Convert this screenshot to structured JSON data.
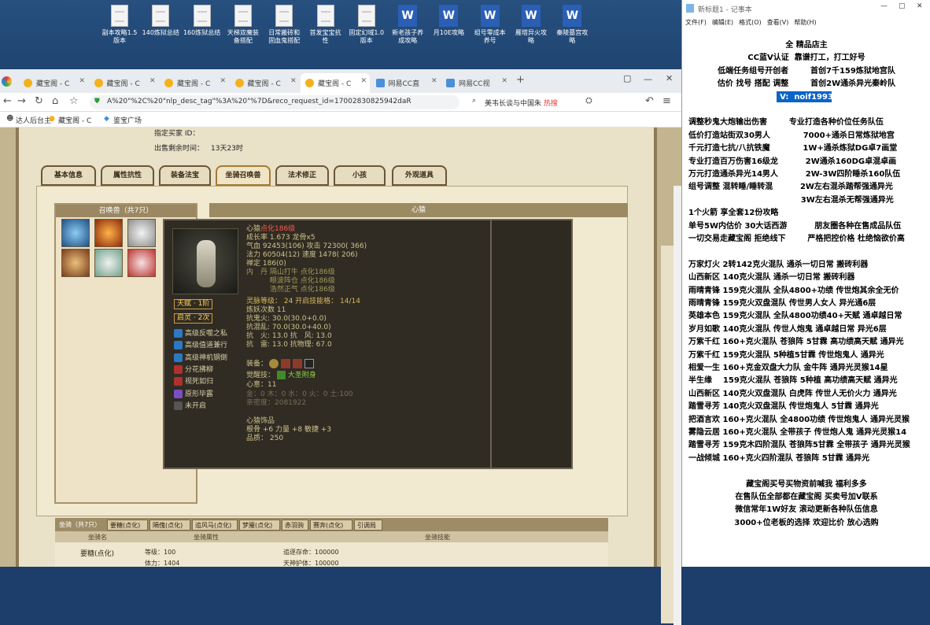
{
  "desktop_icons": [
    {
      "label": "副本攻略1.5\n版本",
      "type": "doc"
    },
    {
      "label": "140炼狱总结",
      "type": "doc"
    },
    {
      "label": "160炼狱总结",
      "type": "doc"
    },
    {
      "label": "天梯双魔装\n备搭配",
      "type": "doc"
    },
    {
      "label": "日常搬砖和\n固血鬼搭配",
      "type": "doc"
    },
    {
      "label": "首发宝宝抗\n性",
      "type": "doc"
    },
    {
      "label": "固定幻域1.0\n版本",
      "type": "doc"
    },
    {
      "label": "新老孩子养\n成攻略",
      "type": "word"
    },
    {
      "label": "月10E攻略",
      "type": "word"
    },
    {
      "label": "组号零成本\n养号",
      "type": "word"
    },
    {
      "label": "雁塔异火攻\n略",
      "type": "word"
    },
    {
      "label": "秦陵墓宫攻\n略",
      "type": "word"
    }
  ],
  "browser": {
    "tabs": [
      {
        "label": "藏宝阁 - C"
      },
      {
        "label": "藏宝阁 - C"
      },
      {
        "label": "藏宝阁 - C"
      },
      {
        "label": "藏宝阁 - C"
      },
      {
        "label": "藏宝阁 - C"
      },
      {
        "label": "网易CC直"
      },
      {
        "label": "网易CC视"
      }
    ],
    "url": "A%20\"%2C%20\"nlp_desc_tag\"%3A%20\"%7D&reco_request_id=17002830825942daR",
    "search": "美韦长谈与中国朱",
    "hot_label": "热搜",
    "bookmarks": [
      "达人后台主",
      "藏宝阁 - C",
      "鉴宝广场"
    ]
  },
  "page": {
    "seller_line": "指定买家 ID：",
    "remaining_label": "出售剩余时间：",
    "remaining_value": "13天23时",
    "tabs": [
      "基本信息",
      "属性抗性",
      "装备法宝",
      "坐骑召唤兽",
      "法术修正",
      "小孩",
      "外观道具"
    ],
    "summon_title": "召唤兽（共7只）",
    "xinhou_title": "心猿",
    "tooltip": {
      "name": "心猿",
      "name_tag": "点化186级",
      "lines": [
        "成长率 1.673  龙骨x5",
        "气血 92453(106) 攻击 72300( 366)",
        "法力 60504(12) 速度 1478( 206)",
        "禅定 186(0)",
        "内　丹 隔山打牛 点化186级",
        "　　　 眼波阵仓 点化186级",
        "　　　 浩然正气 点化186级",
        "灵脉等级：  24 开启技能格： 14/14",
        "炼妖次数 11",
        "抗鬼火: 30.0(30.0+0.0)",
        "抗混乱: 70.0(30.0+40.0)",
        "抗　火: 13.0 抗　风: 13.0",
        "抗　雷: 13.0 抗物理: 67.0"
      ],
      "equip_label": "装备：",
      "awaken_label": "觉醒技：",
      "awaken_value": "大圣附身",
      "heart_label": "心意：",
      "heart_value": "11",
      "elements": "金：0 木：0 水：0 火：0 土:100",
      "intimacy": "亲密度：2081922",
      "ornament_title": "心猿饰品",
      "ornament_stats": "根骨 +6 力量 +8 敏捷 +3",
      "ornament_quality": "品质：  250",
      "badges": [
        "天赋 · 1阶",
        "启灵 · 2次"
      ],
      "skills": [
        "高级反噬之私",
        "高级值道兼行",
        "高级神机钢倒",
        "分花拂柳",
        "视死如归",
        "原形毕露",
        "未开启"
      ]
    },
    "bottom_tabs": [
      "坐骑（共7只）",
      "要糖(点化)",
      "隔傀(点化)",
      "追风马(点化)",
      "梦魇(点化)",
      "赤羽驹",
      "赛奔(点化)",
      "引调局"
    ],
    "bottom_headers": [
      "坐骑名",
      "坐骑属性",
      "坐骑技能"
    ],
    "mount_name": "要糖(点化)",
    "mount_level": "等级：100",
    "mount_stamina": "体力：1404",
    "mount_stat1": "追逐存命：100000",
    "mount_stat2": "天神护体：100000"
  },
  "notepad": {
    "title": "新标题1 - 记事本",
    "menu": [
      "文件(F)",
      "编辑(E)",
      "格式(O)",
      "查看(V)",
      "帮助(H)"
    ],
    "lines": [
      "全 精品店主",
      "CC蓝V认证  靠谱打工，打工好号",
      "低端任务组号开创者        首创7千159炼狱地宫队",
      "估价 找号 搭配 调整        首创2W通杀异光秦岭队",
      "V:  noif1993",
      "",
      "调整秒鬼大炮输出伤害        专业打造各种价位任务队伍",
      "低价打造站街双30男人            7000+通杀日常炼狱地宫",
      "千元打造七抗/八抗铁魔            1W+通杀炼狱DG卓7画堂",
      "专业打造百万伤害16级龙          2W通杀160DG卓混卓画",
      "万元打造通杀异光14男人          2W-3W四阶睡杀160队伍",
      "组号调整 混转睡/睡转混          2W左右混杀踏帮强通异光",
      "                                         3W左右混杀无帮强通异光",
      "1个火箭 享全套12份攻略",
      "单号5W内估价 30大话西游          朋友圈各种在售成品队伍",
      "一切交易走藏宝阁 拒绝线下        严格把控价格 杜绝恼欲价高",
      "",
      "万家灯火 2转142克火混队 通杀一切日常 搬砖利器",
      "山西新区 140克火混队 通杀一切日常 搬砖利器",
      "雨晴青锋 159克火混队 全队4800+功绩 传世炮其余全无价",
      "雨晴青锋 159克火双盘混队 传世男人女人 异光通6层",
      "英雄本色 159克火混队 全队4800功绩40+天赋 通卓越日常",
      "岁月如歌 140克火混队 传世人炮鬼 通卓越日常 异光6层",
      "万紫千红 160+克火混队 苍狼阵 5甘霖 高功绩高天赋 通异光",
      "万紫千红 159克火混队 5种植5甘霖 传世炮鬼人 通异光",
      "相爱一生 160+克金双盘大力队 金牛阵 通异光灵猴14星",
      "半生缘    159克火混队 苍狼阵 5种植 高功绩高天赋 通异光",
      "山西新区 140克火双盘混队 白虎阵 传世人无价火力 通异光",
      "踏雪寻芳 140克火双盘混队 传世炮鬼人 5甘霖 通异光",
      "把酒言欢 160+克火混队 全4800功绩 传世炮鬼人 通异光灵猴",
      "雾隐云居 160+克火混队 全带孩子 传世炮人鬼 通异光灵猴14",
      "踏雪寻芳 159克木四阶混队 苍狼阵5甘霖 全带孩子 通异光灵猴",
      "一战倾城 160+克火四阶混队 苍狼阵 5甘霖 通异光",
      "",
      "藏宝阁买号买物资前喊我 福利多多",
      "在售队伍全部都在藏宝阁 买卖号加V联系",
      "微信常年1W好友 滚动更新各种队伍信息",
      "3000+位老板的选择 欢迎比价 放心选购"
    ]
  }
}
